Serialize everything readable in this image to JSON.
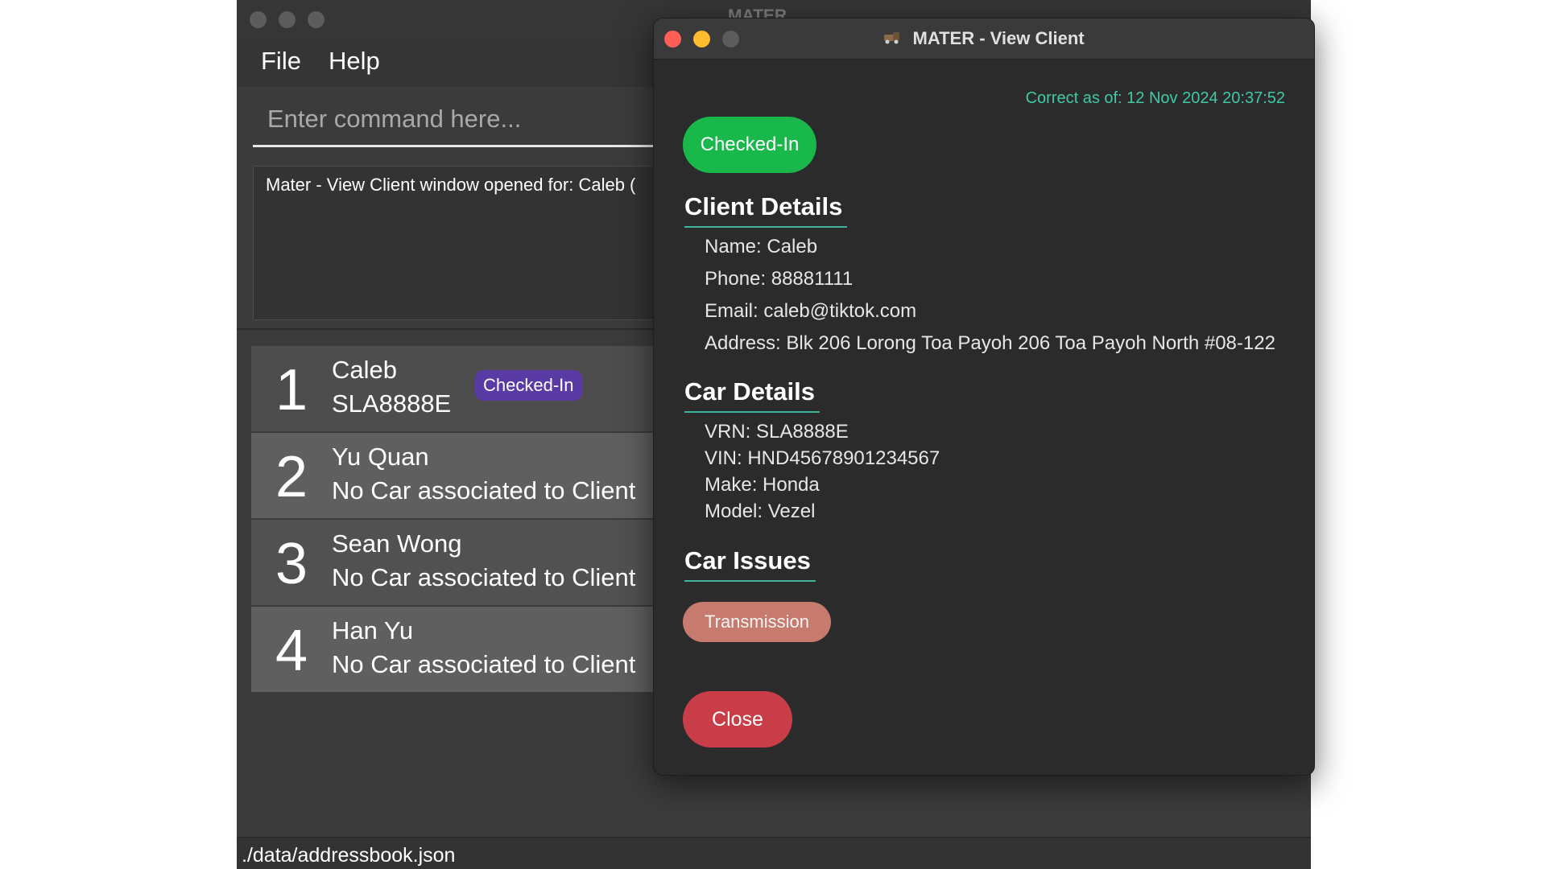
{
  "main_window": {
    "title": "MATER",
    "menu": [
      "File",
      "Help"
    ],
    "command_placeholder": "Enter command here...",
    "result_text": "Mater - View Client window opened for: Caleb (",
    "clients": [
      {
        "index": "1",
        "name": "Caleb",
        "car": "SLA8888E",
        "badge": "Checked-In"
      },
      {
        "index": "2",
        "name": "Yu Quan",
        "car": "No Car associated to Client"
      },
      {
        "index": "3",
        "name": "Sean Wong",
        "car": "No Car associated to Client"
      },
      {
        "index": "4",
        "name": "Han Yu",
        "car": "No Car associated to Client"
      }
    ],
    "status_path": "./data/addressbook.json"
  },
  "view_window": {
    "title": "MATER - View Client",
    "timestamp": "Correct as of: 12 Nov 2024 20:37:52",
    "status": "Checked-In",
    "client_details": {
      "heading": "Client Details",
      "name": "Name: Caleb",
      "phone": "Phone: 88881111",
      "email": "Email: caleb@tiktok.com",
      "address": "Address: Blk 206 Lorong Toa Payoh 206 Toa Payoh North #08-122"
    },
    "car_details": {
      "heading": "Car Details",
      "vrn": "VRN: SLA8888E",
      "vin": "VIN: HND45678901234567",
      "make": "Make: Honda",
      "model": "Model: Vezel"
    },
    "car_issues": {
      "heading": "Car Issues",
      "issues": [
        "Transmission"
      ]
    },
    "close_label": "Close"
  },
  "colors": {
    "checked_in_green": "#18b84a",
    "checked_in_purple": "#5a3aa5",
    "close_red": "#c83d48",
    "issue_tag": "#c77b6e",
    "timestamp_teal": "#3fc9a5",
    "traffic_close": "#ff5f57",
    "traffic_minimize": "#febc2e",
    "traffic_zoom_inactive": "#5c5c5c"
  }
}
